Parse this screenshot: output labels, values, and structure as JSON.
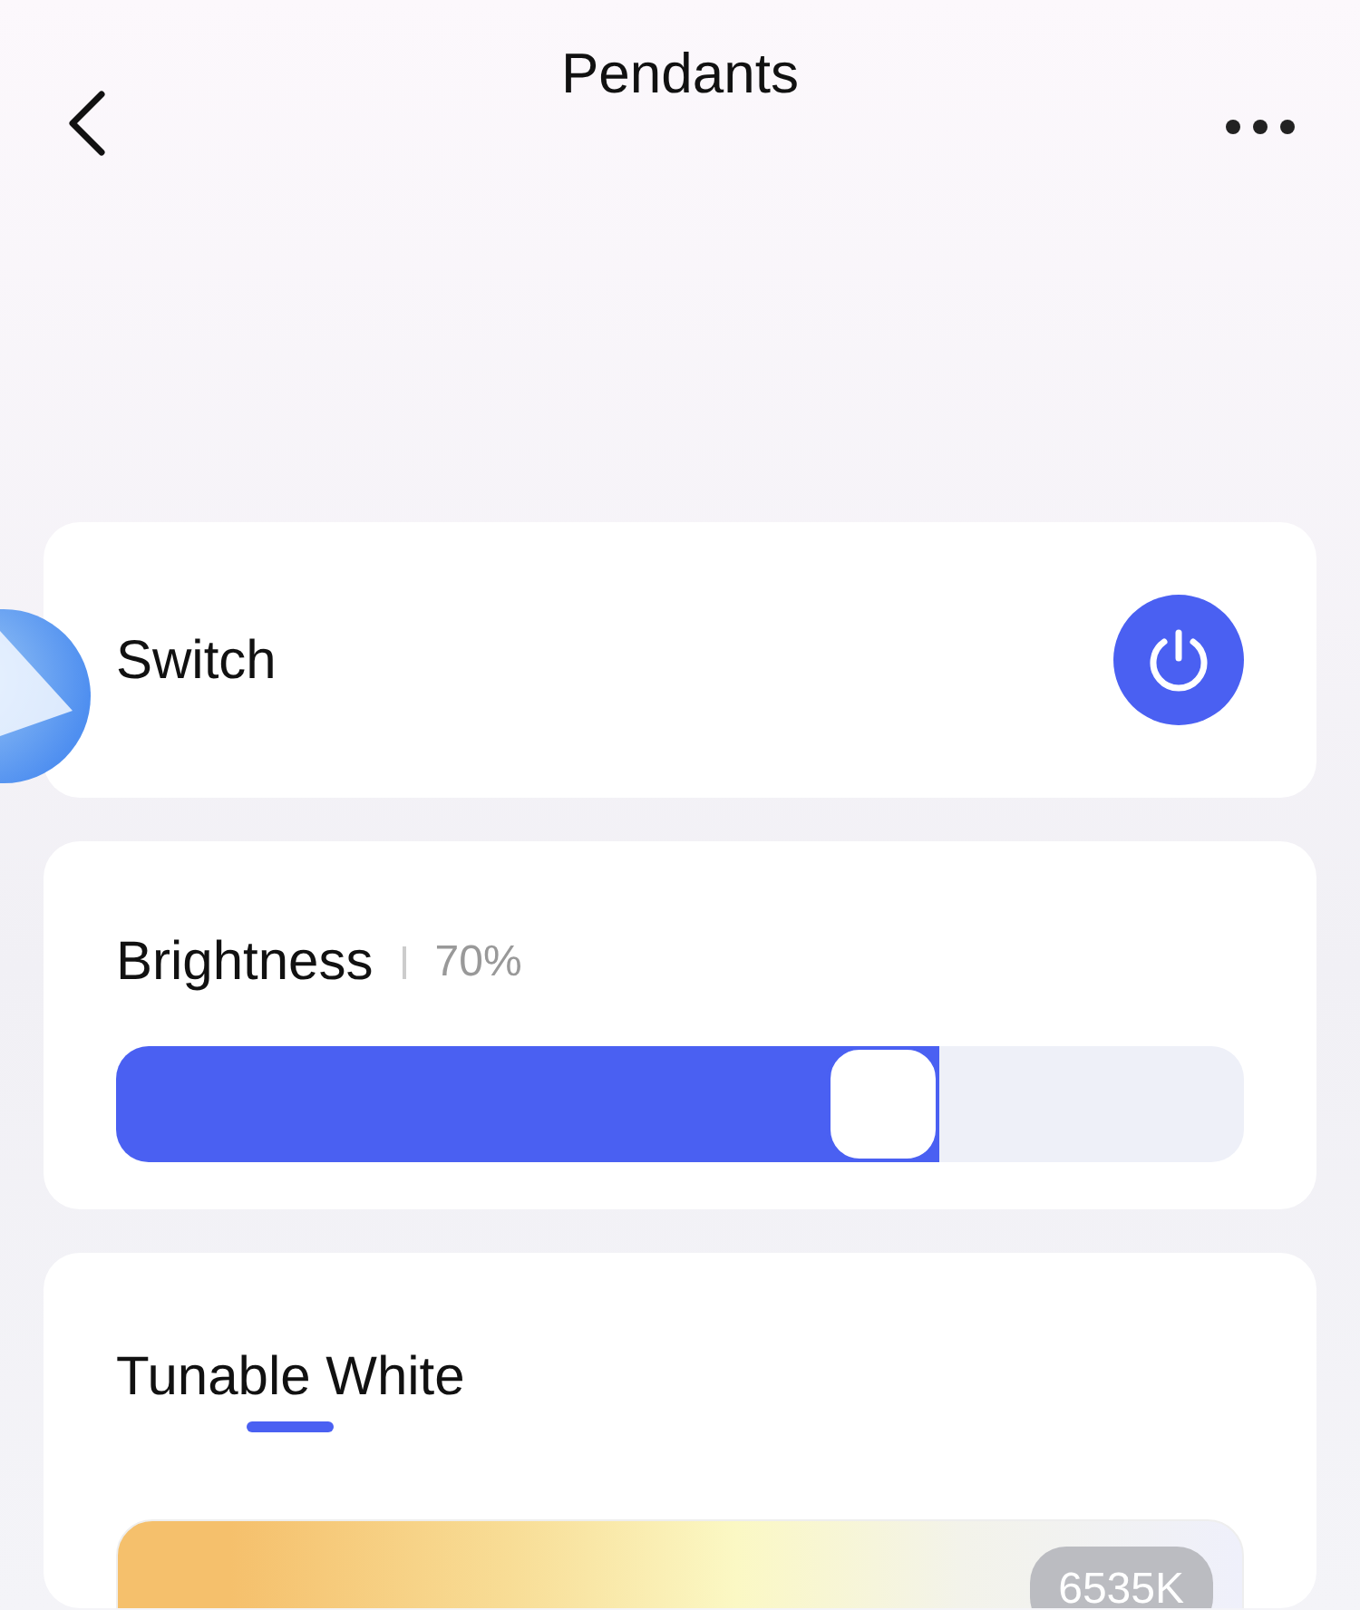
{
  "header": {
    "title": "Pendants"
  },
  "switch": {
    "label": "Switch",
    "on": true
  },
  "brightness": {
    "label": "Brightness",
    "reading": "70%",
    "level": 0.73
  },
  "tabs": [
    {
      "label": "Tunable White",
      "selected": true
    }
  ],
  "color_temperature": {
    "reading": "6535K"
  }
}
